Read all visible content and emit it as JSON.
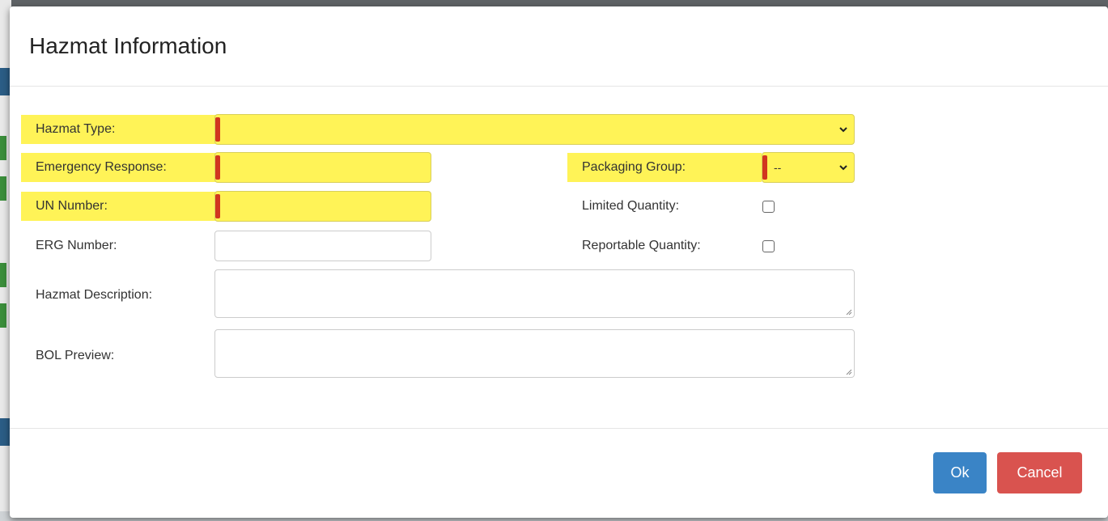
{
  "dialog": {
    "title": "Hazmat Information"
  },
  "form": {
    "hazmat_type_label": "Hazmat Type:",
    "hazmat_type_value": "",
    "emergency_response_label": "Emergency Response:",
    "emergency_response_value": "",
    "un_number_label": "UN Number:",
    "un_number_value": "",
    "erg_number_label": "ERG Number:",
    "erg_number_value": "",
    "hazmat_description_label": "Hazmat Description:",
    "bol_preview_label": "BOL Preview:",
    "packaging_group_label": "Packaging Group:",
    "packaging_group_value": "--",
    "limited_quantity_label": "Limited Quantity:",
    "limited_quantity_checked": false,
    "reportable_quantity_label": "Reportable Quantity:",
    "reportable_quantity_checked": false
  },
  "footer": {
    "ok_label": "Ok",
    "cancel_label": "Cancel"
  },
  "colors": {
    "required_highlight": "#fff357",
    "required_marker": "#d1361f",
    "ok_button": "#3a84c6",
    "cancel_button": "#d9534f"
  },
  "icons": {
    "select_arrow": "chevron-down-icon",
    "textarea_resize": "resize-grip-icon"
  }
}
